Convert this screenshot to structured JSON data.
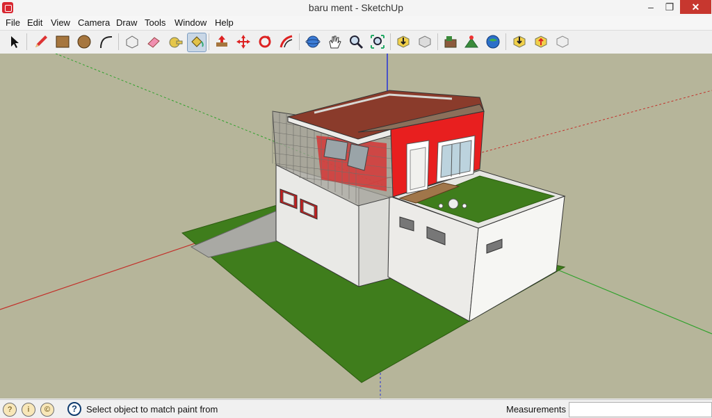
{
  "window": {
    "title": "baru ment - SketchUp",
    "minimize": "–",
    "restore": "❐",
    "close": "✕"
  },
  "menu": {
    "items": [
      "File",
      "Edit",
      "View",
      "Camera",
      "Draw",
      "Tools",
      "Window",
      "Help"
    ]
  },
  "toolbar": {
    "tools": [
      "select-icon",
      "pencil-icon",
      "rectangle-icon",
      "circle-icon",
      "arc-icon",
      "make-component-icon",
      "eraser-icon",
      "tape-measure-icon",
      "paint-bucket-icon",
      "push-pull-icon",
      "move-icon",
      "rotate-icon",
      "offset-icon",
      "orbit-icon",
      "pan-icon",
      "zoom-icon",
      "zoom-extents-icon",
      "get-models-icon",
      "share-model-icon",
      "add-location-icon",
      "toggle-terrain-icon",
      "preview-google-earth-icon",
      "get-components-icon",
      "share-component-icon",
      "extension-warehouse-icon"
    ],
    "active_tool": "paint-bucket-icon"
  },
  "status": {
    "message": "Select object to match paint from",
    "measurements_label": "Measurements",
    "measurements_value": "",
    "icons": [
      "geo-location-icon",
      "credits-icon",
      "copyright-icon"
    ]
  },
  "colors": {
    "sky_ground": "#b6b59a",
    "lawn": "#3f7d1c",
    "red_wall": "#e81f1f",
    "roof": "#8a3b2b"
  }
}
